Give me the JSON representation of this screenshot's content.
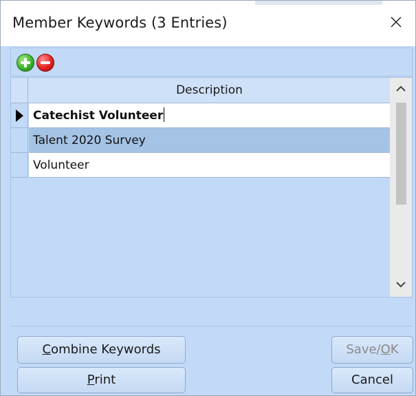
{
  "window": {
    "title": "Member Keywords (3 Entries)",
    "close_symbol": "✕"
  },
  "toolbar": {
    "add_icon": "green-plus-circle-icon",
    "remove_icon": "red-minus-circle-icon"
  },
  "grid": {
    "header": "Description",
    "rows": [
      {
        "description": "Catechist Volunteer",
        "state": "editing"
      },
      {
        "description": "Talent 2020 Survey",
        "state": "selected"
      },
      {
        "description": "Volunteer",
        "state": "normal"
      }
    ]
  },
  "buttons": {
    "combine": {
      "mnemonic": "C",
      "rest": "ombine Keywords"
    },
    "print": {
      "mnemonic": "P",
      "rest": "rint"
    },
    "save": {
      "pre": "Save/",
      "mnemonic": "O",
      "rest": "K",
      "enabled": false
    },
    "cancel": {
      "label": "Cancel"
    }
  },
  "colors": {
    "window_bg": "#c2d9f7",
    "selected_row": "#a4c3e5",
    "disabled_text": "#8a8a8a"
  }
}
